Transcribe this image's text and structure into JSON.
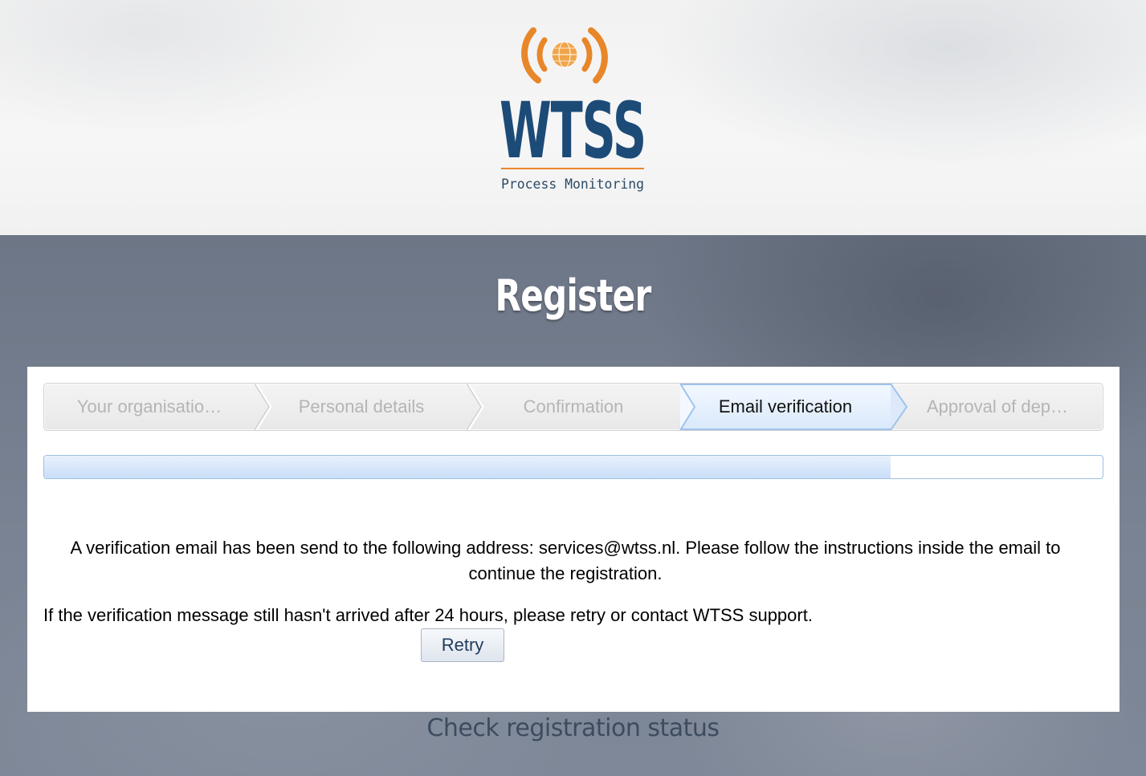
{
  "header": {
    "logo_title": "WTSS",
    "logo_subtitle": "Process Monitoring"
  },
  "page_title": "Register",
  "wizard": {
    "steps": [
      {
        "label": "Your organisatio…",
        "state": "done"
      },
      {
        "label": "Personal details",
        "state": "done"
      },
      {
        "label": "Confirmation",
        "state": "done"
      },
      {
        "label": "Email verification",
        "state": "active"
      },
      {
        "label": "Approval of dep…",
        "state": "pending"
      }
    ],
    "progress_fraction": 0.8
  },
  "message": {
    "line1": "A verification email has been send to the following address: services@wtss.nl. Please follow the instructions inside the email to continue the registration.",
    "line2": "If the verification message still hasn't arrived after 24 hours, please retry or contact WTSS support.",
    "retry_label": "Retry"
  },
  "footer": {
    "check_status_link": "Check registration status"
  },
  "colors": {
    "brand_blue": "#1d4b78",
    "brand_orange": "#e8862a",
    "active_step_border": "#9ec4ec"
  }
}
